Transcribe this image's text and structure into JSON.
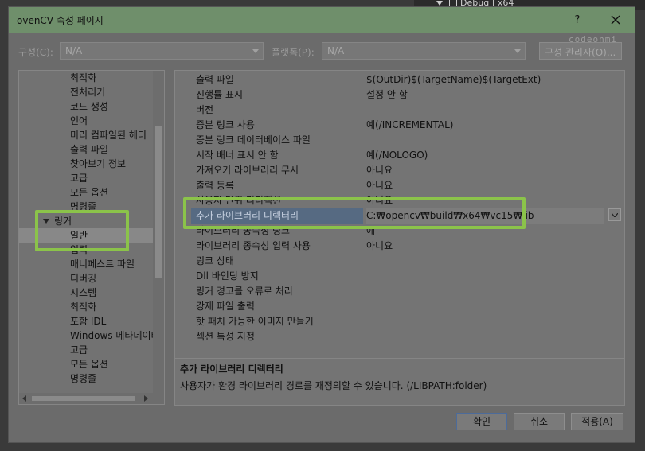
{
  "background": {
    "debug_label": "Debug | x64"
  },
  "window": {
    "title": "ovenCV 속성 페이지",
    "help_label": "?",
    "watermark": "codeonmi"
  },
  "config": {
    "config_label": "구성(C):",
    "config_value": "N/A",
    "platform_label": "플랫폼(P):",
    "platform_value": "N/A",
    "manager_label": "구성 관리자(O)..."
  },
  "tree": {
    "items": [
      {
        "label": "최적화"
      },
      {
        "label": "전처리기"
      },
      {
        "label": "코드 생성"
      },
      {
        "label": "언어"
      },
      {
        "label": "미리 컴파일된 헤더"
      },
      {
        "label": "출력 파일"
      },
      {
        "label": "찾아보기 정보"
      },
      {
        "label": "고급"
      },
      {
        "label": "모든 옵션"
      },
      {
        "label": "명령줄"
      },
      {
        "label": "링커"
      },
      {
        "label": "일반"
      },
      {
        "label": "입력"
      },
      {
        "label": "매니페스트 파일"
      },
      {
        "label": "디버깅"
      },
      {
        "label": "시스템"
      },
      {
        "label": "최적화"
      },
      {
        "label": "포함 IDL"
      },
      {
        "label": "Windows 메타데이터"
      },
      {
        "label": "고급"
      },
      {
        "label": "모든 옵션"
      },
      {
        "label": "명령줄"
      }
    ]
  },
  "properties": [
    {
      "name": "출력 파일",
      "value": "$(OutDir)$(TargetName)$(TargetExt)"
    },
    {
      "name": "진행률 표시",
      "value": "설정 안 함"
    },
    {
      "name": "버전",
      "value": ""
    },
    {
      "name": "증분 링크 사용",
      "value": "예(/INCREMENTAL)"
    },
    {
      "name": "증분 링크 데이터베이스 파일",
      "value": ""
    },
    {
      "name": "시작 배너 표시 안 함",
      "value": "예(/NOLOGO)"
    },
    {
      "name": "가져오기 라이브러리 무시",
      "value": "아니요"
    },
    {
      "name": "출력 등록",
      "value": "아니요"
    },
    {
      "name": "사용자 단위 리디렉션",
      "value": "아니요"
    },
    {
      "name": "추가 라이브러리 디렉터리",
      "value": "C:₩opencv₩build₩x64₩vc15₩lib"
    },
    {
      "name": "라이브러리 종속성 링크",
      "value": "예"
    },
    {
      "name": "라이브러리 종속성 입력 사용",
      "value": "아니요"
    },
    {
      "name": "링크 상태",
      "value": ""
    },
    {
      "name": "Dll 바인딩 방지",
      "value": ""
    },
    {
      "name": "링커 경고를 오류로 처리",
      "value": ""
    },
    {
      "name": "강제 파일 출력",
      "value": ""
    },
    {
      "name": "핫 패치 가능한 이미지 만들기",
      "value": ""
    },
    {
      "name": "섹션 특성 지정",
      "value": ""
    }
  ],
  "description": {
    "title": "추가 라이브러리 디렉터리",
    "text": "사용자가 환경 라이브러리 경로를 재정의할 수 있습니다. (/LIBPATH:folder)"
  },
  "buttons": {
    "ok": "확인",
    "cancel": "취소",
    "apply": "적용(A)"
  },
  "colors": {
    "highlight": "#8bc34a",
    "titlebar": "#6f8f6b",
    "selection": "#566a82"
  }
}
